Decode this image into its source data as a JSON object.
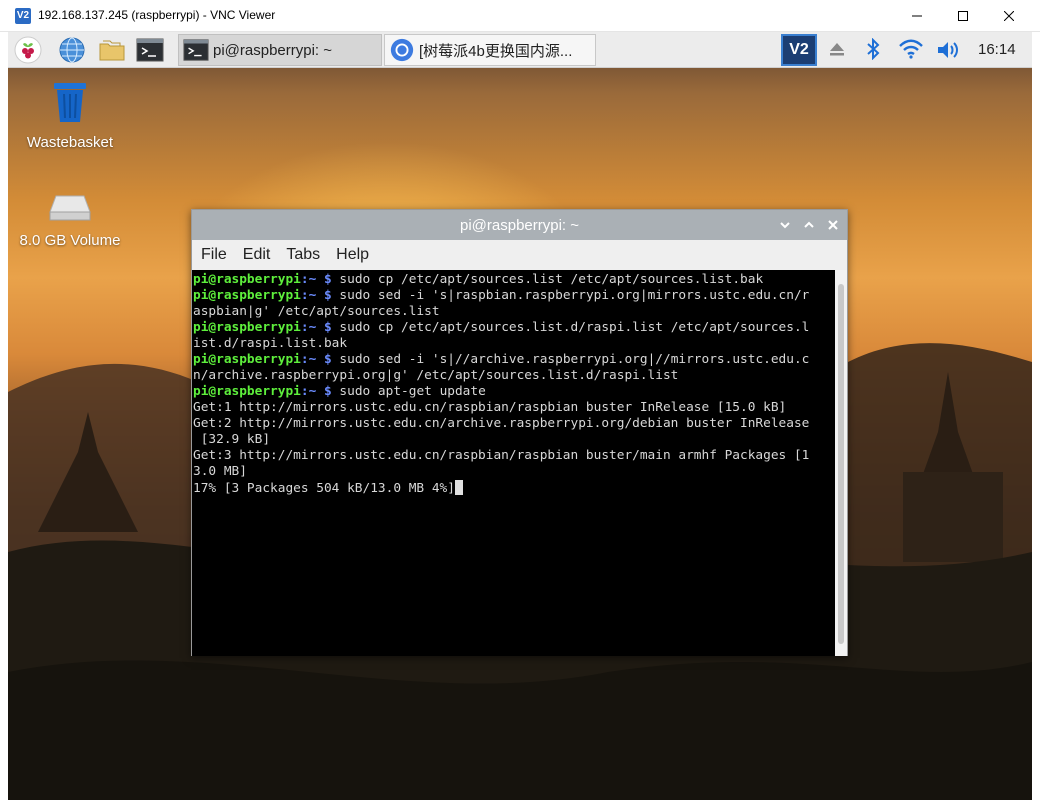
{
  "host_window": {
    "icon_text": "V2",
    "title": "192.168.137.245 (raspberrypi) - VNC Viewer"
  },
  "taskbar": {
    "tasks": [
      {
        "label": "pi@raspberrypi: ~",
        "icon": "terminal-icon"
      },
      {
        "label": "[树莓派4b更换国内源...",
        "icon": "chromium-icon"
      }
    ],
    "tray": {
      "vnc_text": "V2",
      "clock": "16:14"
    },
    "icons": [
      "raspberry-menu-icon",
      "globe-icon",
      "folder-icon",
      "terminal-icon",
      "eject-icon",
      "bluetooth-icon",
      "wifi-icon",
      "volume-icon"
    ]
  },
  "desktop": {
    "icons": [
      {
        "label": "Wastebasket",
        "icon": "trash-icon"
      },
      {
        "label": "8.0 GB Volume",
        "icon": "drive-icon"
      }
    ]
  },
  "terminal": {
    "title": "pi@raspberrypi: ~",
    "menu": [
      "File",
      "Edit",
      "Tabs",
      "Help"
    ],
    "prompt_user": "pi@raspberrypi",
    "prompt_path": ":~ $",
    "lines": [
      {
        "type": "cmd",
        "text": " sudo cp /etc/apt/sources.list /etc/apt/sources.list.bak"
      },
      {
        "type": "cmd",
        "text": " sudo sed -i 's|raspbian.raspberrypi.org|mirrors.ustc.edu.cn/r"
      },
      {
        "type": "out",
        "text": "aspbian|g' /etc/apt/sources.list"
      },
      {
        "type": "cmd",
        "text": " sudo cp /etc/apt/sources.list.d/raspi.list /etc/apt/sources.l"
      },
      {
        "type": "out",
        "text": "ist.d/raspi.list.bak"
      },
      {
        "type": "cmd",
        "text": " sudo sed -i 's|//archive.raspberrypi.org|//mirrors.ustc.edu.c"
      },
      {
        "type": "out",
        "text": "n/archive.raspberrypi.org|g' /etc/apt/sources.list.d/raspi.list"
      },
      {
        "type": "cmd",
        "text": " sudo apt-get update"
      },
      {
        "type": "out",
        "text": "Get:1 http://mirrors.ustc.edu.cn/raspbian/raspbian buster InRelease [15.0 kB]"
      },
      {
        "type": "out",
        "text": "Get:2 http://mirrors.ustc.edu.cn/archive.raspberrypi.org/debian buster InRelease"
      },
      {
        "type": "out",
        "text": " [32.9 kB]"
      },
      {
        "type": "out",
        "text": "Get:3 http://mirrors.ustc.edu.cn/raspbian/raspbian buster/main armhf Packages [1"
      },
      {
        "type": "out",
        "text": "3.0 MB]"
      },
      {
        "type": "out",
        "text": "17% [3 Packages 504 kB/13.0 MB 4%]"
      }
    ]
  }
}
